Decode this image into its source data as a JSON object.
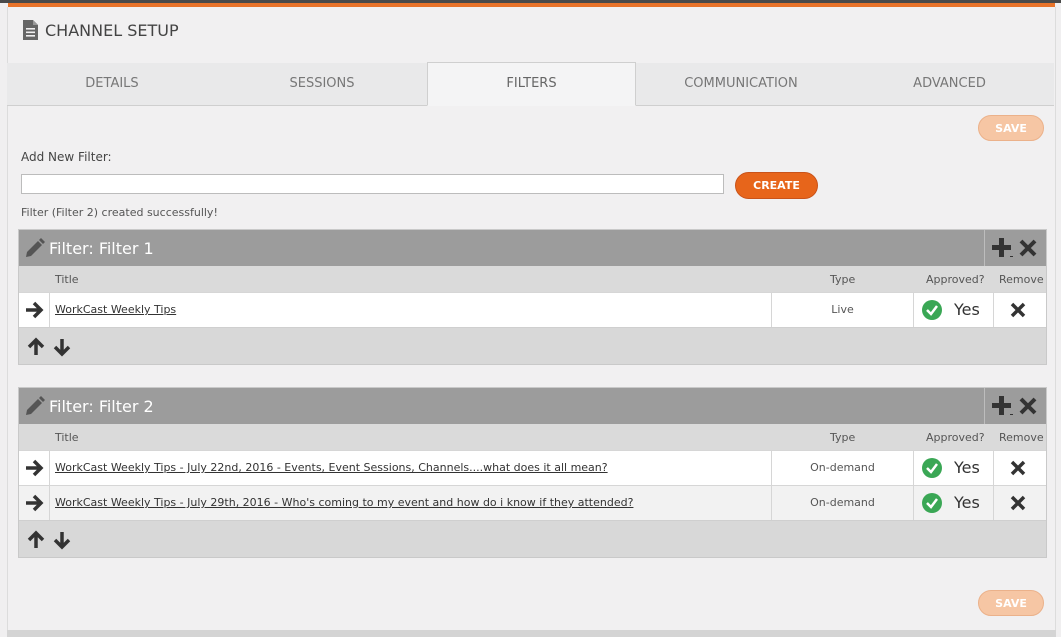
{
  "page": {
    "title": "CHANNEL SETUP",
    "icon": "document-icon"
  },
  "tabs": [
    {
      "label": "DETAILS",
      "active": false
    },
    {
      "label": "SESSIONS",
      "active": false
    },
    {
      "label": "FILTERS",
      "active": true
    },
    {
      "label": "COMMUNICATION",
      "active": false
    },
    {
      "label": "ADVANCED",
      "active": false
    }
  ],
  "actions": {
    "save_label": "SAVE",
    "create_label": "CREATE"
  },
  "add_filter": {
    "label": "Add New Filter:",
    "value": "",
    "status": "Filter (Filter 2) created successfully!"
  },
  "columns": {
    "title": "Title",
    "type": "Type",
    "approved": "Approved?",
    "remove": "Remove"
  },
  "filters": [
    {
      "name": "Filter: Filter 1",
      "rows": [
        {
          "title": "WorkCast Weekly Tips",
          "type": "Live",
          "approved": "Yes"
        }
      ]
    },
    {
      "name": "Filter: Filter 2",
      "rows": [
        {
          "title": "WorkCast Weekly Tips - July 22nd, 2016 - Events, Event Sessions, Channels....what does it all mean?",
          "type": "On-demand",
          "approved": "Yes"
        },
        {
          "title": "WorkCast Weekly Tips - July 29th, 2016 - Who's coming to my event and how do i know if they attended?",
          "type": "On-demand",
          "approved": "Yes"
        }
      ]
    }
  ],
  "colors": {
    "accent": "#e7651b",
    "accent_disabled": "#f6c6a4",
    "approved": "#3aa755",
    "header_gray": "#9c9c9c"
  }
}
